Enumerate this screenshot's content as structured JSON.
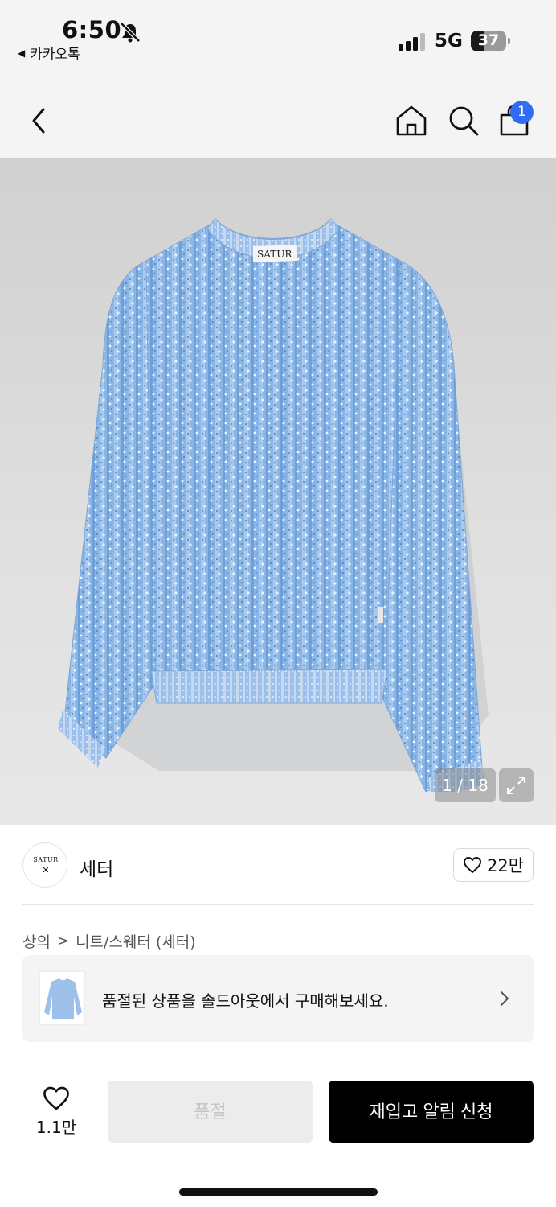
{
  "status_bar": {
    "time": "6:50",
    "back_app": "카카오톡",
    "network": "5G",
    "battery_level": "37",
    "battery_fraction": 0.37
  },
  "nav": {
    "icons": [
      "back-chevron-icon",
      "home-icon",
      "search-icon",
      "shopping-bag-icon"
    ],
    "cart_count": "1"
  },
  "gallery": {
    "page_indicator": "1 / 18",
    "current": 1,
    "total": 18
  },
  "brand": {
    "logo_text": "SATUR",
    "logo_mark": "✕",
    "name": "세터",
    "like_count": "22만"
  },
  "breadcrumb": {
    "level1": "상의",
    "separator": ">",
    "level2": "니트/스웨터 (세터)"
  },
  "banner": {
    "text": "품절된 상품을 솔드아웃에서 구매해보세요."
  },
  "bottom_bar": {
    "wish_count": "1.1만",
    "soldout_label": "품절",
    "restock_label": "재입고 알림 신청"
  },
  "colors": {
    "accent_badge": "#2f6df6",
    "primary_button": "#000000",
    "disabled_button": "#ececec",
    "header_bg": "#f4f4f4"
  }
}
